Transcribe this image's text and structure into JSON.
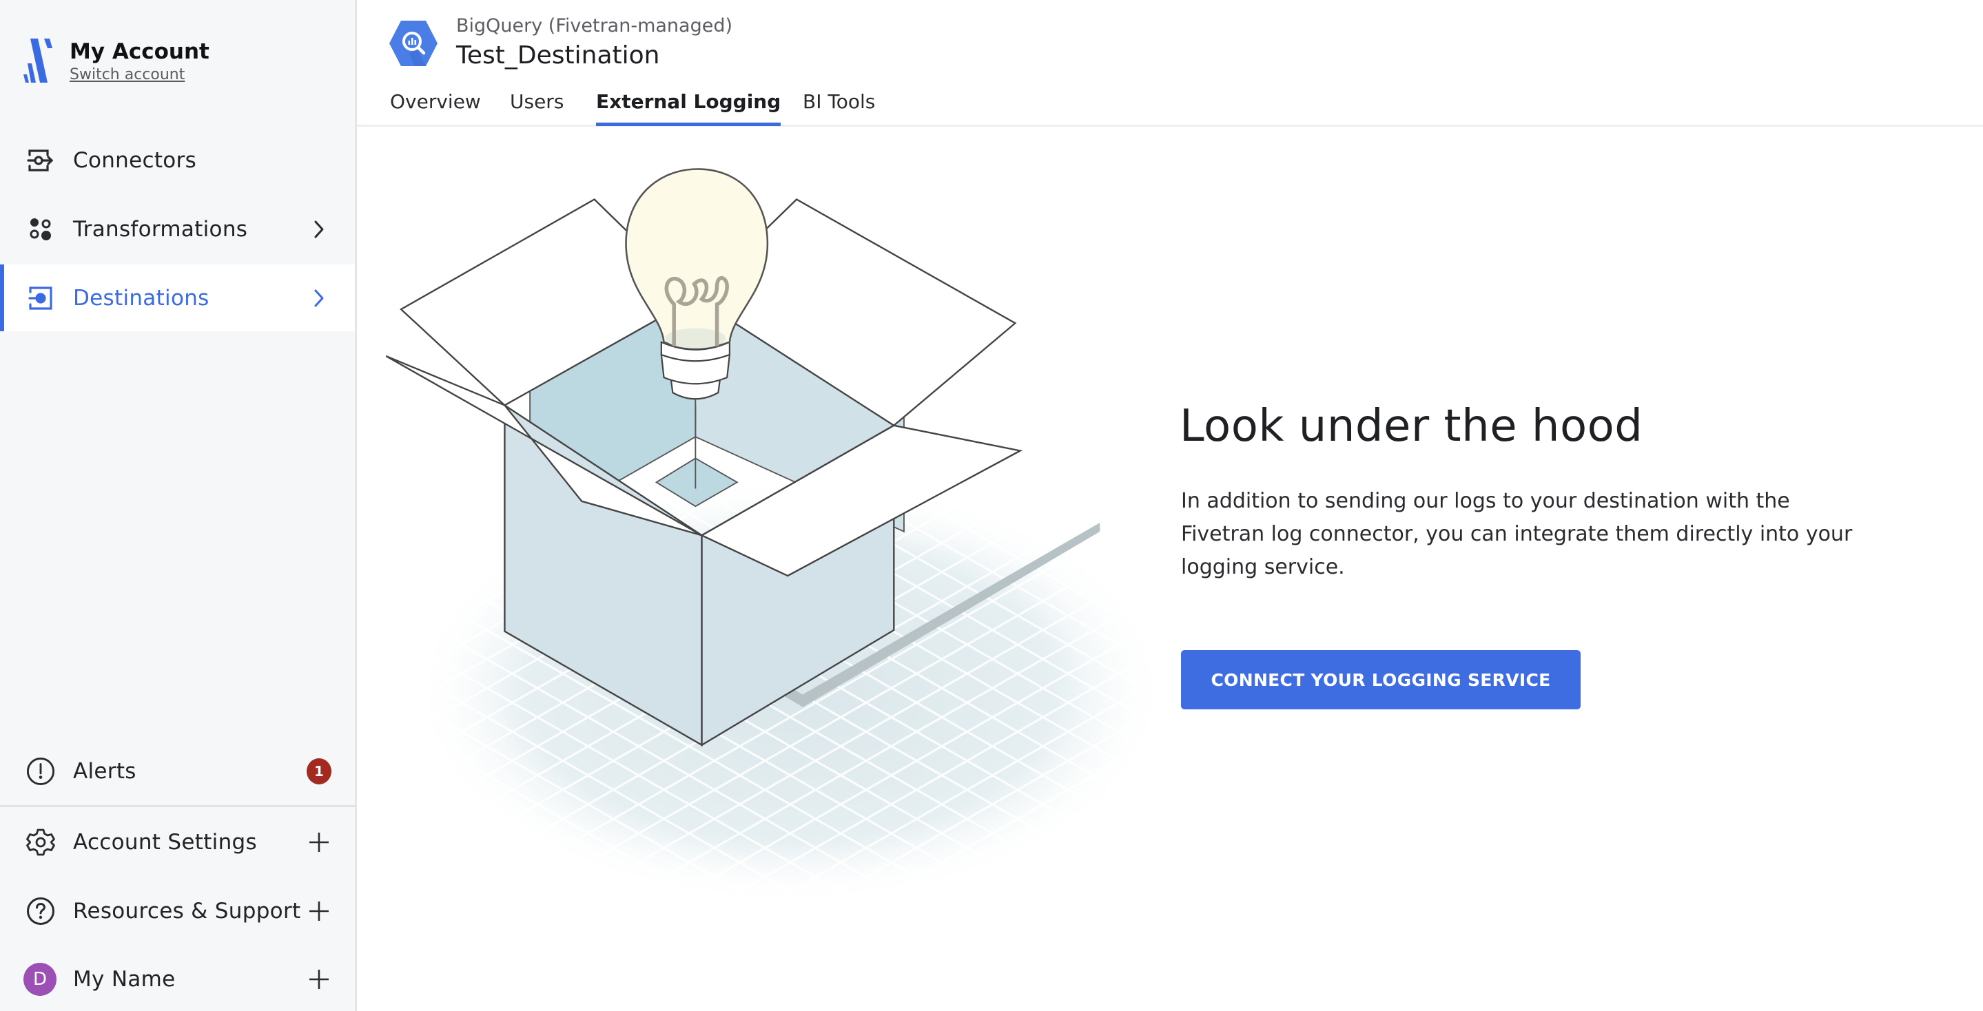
{
  "sidebar": {
    "account_name": "My Account",
    "switch_account": "Switch account",
    "nav": [
      {
        "label": "Connectors",
        "icon": "connectors-icon"
      },
      {
        "label": "Transformations",
        "icon": "transformations-icon",
        "trail": "chevron-right"
      },
      {
        "label": "Destinations",
        "icon": "destinations-icon",
        "trail": "chevron-right",
        "active": true
      }
    ],
    "bottom": [
      {
        "label": "Alerts",
        "icon": "alert-icon",
        "badge": "1"
      },
      {
        "label": "Account Settings",
        "icon": "gear-icon",
        "trail": "plus"
      },
      {
        "label": "Resources & Support",
        "icon": "help-icon",
        "trail": "plus"
      },
      {
        "label": "My Name",
        "avatar_initial": "D",
        "trail": "plus"
      }
    ]
  },
  "header": {
    "subtitle": "BigQuery (Fivetran-managed)",
    "title": "Test_Destination",
    "tabs": [
      {
        "label": "Overview"
      },
      {
        "label": "Users"
      },
      {
        "label": "External Logging",
        "active": true
      },
      {
        "label": "BI Tools"
      }
    ]
  },
  "main": {
    "heading": "Look under the hood",
    "body": "In addition to sending our logs to your destination with the Fivetran log connector, you can integrate them directly into your logging service.",
    "cta_label": "CONNECT YOUR LOGGING SERVICE"
  },
  "colors": {
    "accent": "#3b6be0",
    "badge": "#a32a20",
    "avatar": "#9c4fb5",
    "sidebar_bg": "#f6f7f9"
  }
}
